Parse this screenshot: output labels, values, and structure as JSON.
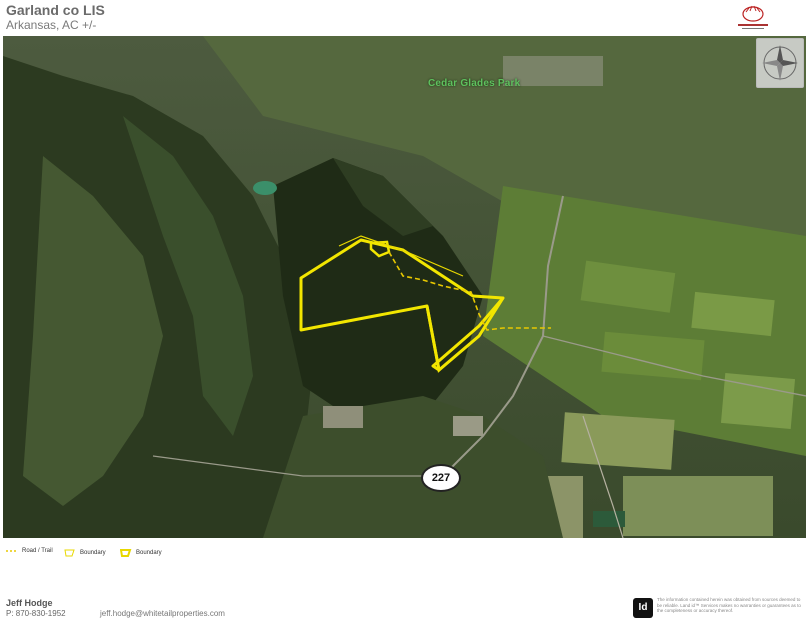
{
  "header": {
    "title": "Garland co LIS",
    "subtitle": "Arkansas,  AC +/-"
  },
  "map": {
    "park_label": "Cedar Glades Park",
    "road_shield": "227",
    "colors": {
      "boundary": "#f2e600",
      "trail": "#e8c800",
      "forest": "#2f3d22",
      "field": "#5c7a34"
    }
  },
  "legend": {
    "items": [
      {
        "label": "Road / Trail",
        "icon": "dashed-line-icon"
      },
      {
        "label": "Boundary",
        "icon": "boundary-thin-icon"
      },
      {
        "label": "Boundary",
        "icon": "boundary-thick-icon"
      }
    ]
  },
  "footer": {
    "name": "Jeff Hodge",
    "phone": "P: 870-830-1952",
    "email": "jeff.hodge@whitetailproperties.com",
    "disclaimer_logo": "Id",
    "disclaimer": "The information contained herein was obtained from sources deemed to be reliable. Land id™ Services makes no warranties or guarantees as to the completeness or accuracy thereof."
  }
}
